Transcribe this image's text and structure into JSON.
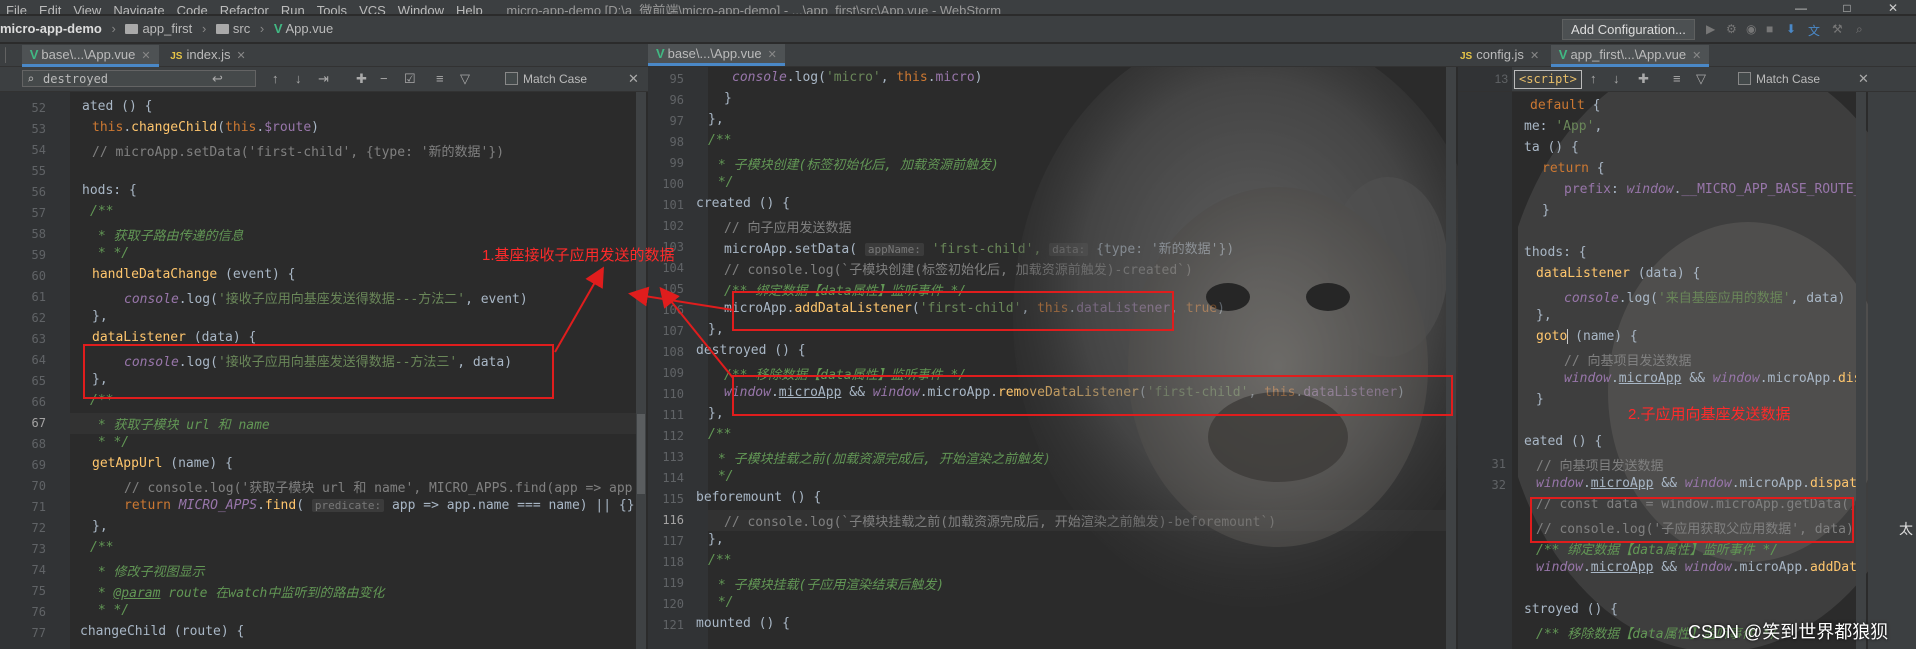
{
  "menu": [
    "File",
    "Edit",
    "View",
    "Navigate",
    "Code",
    "Refactor",
    "Run",
    "Tools",
    "VCS",
    "Window",
    "Help"
  ],
  "window_title": "micro-app-demo [D:\\a_微前端\\micro-app-demo] - ...\\app_first\\src\\App.vue - WebStorm",
  "breadcrumbs": [
    "micro-app-demo",
    "app_first",
    "src",
    "App.vue"
  ],
  "toolbar": {
    "add_config": "Add Configuration..."
  },
  "left_panel": {
    "tabs": [
      {
        "label": "base\\...\\App.vue",
        "active": true
      },
      {
        "label": "index.js",
        "active": false
      }
    ],
    "search": "destroyed",
    "match_case": "Match Case",
    "line_numbers": [
      "52",
      "53",
      "54",
      "55",
      "56",
      "57",
      "58",
      "59",
      "60",
      "61",
      "62",
      "63",
      "64",
      "65",
      "66",
      "67",
      "68",
      "69",
      "70",
      "71",
      "72",
      "73",
      "74",
      "75",
      "76",
      "77"
    ],
    "lines": [
      "ated () {",
      "this.changeChild(this.$route)",
      "// microApp.setData('first-child', {type: '新的数据'})",
      "",
      "hods: {",
      "/**",
      " * 获取子路由传递的信息",
      " * */",
      "handleDataChange (event) {",
      "console.log('接收子应用向基座发送得数据---方法二', event)",
      "},",
      "dataListener (data) {",
      "console.log('接收子应用向基座发送得数据--方法三', data)",
      "},",
      "/**",
      " * 获取子模块 url 和 name",
      " * */",
      "getAppUrl (name) {",
      "// console.log('获取子模块 url 和 name', MICRO_APPS.find(app => app",
      "return MICRO_APPS.find(",
      "predicate:",
      "app => app.name === name) || {}",
      "},",
      "/**",
      " * 修改子视图显示",
      " * @param route 在watch中监听到的路由变化",
      " * */",
      "changeChild (route) {"
    ],
    "annotation": "1.基座接收子应用发送的数据"
  },
  "middle_panel": {
    "tabs": [
      {
        "label": "base\\...\\App.vue",
        "active": true
      }
    ],
    "line_numbers": [
      "95",
      "96",
      "97",
      "98",
      "99",
      "100",
      "101",
      "102",
      "103",
      "104",
      "105",
      "106",
      "107",
      "108",
      "109",
      "110",
      "111",
      "112",
      "113",
      "114",
      "115",
      "116",
      "117",
      "118",
      "119",
      "120",
      "121"
    ],
    "lines": {
      "l95": "console.log('micro', this.micro)",
      "l96": "}",
      "l97": "},",
      "l98": "/**",
      "l99": " * 子模块创建(标签初始化后, 加载资源前触发)",
      "l100": " */",
      "l101": "created () {",
      "l102": "// 向子应用发送数据",
      "l103a": "microApp.setData(",
      "l103h1": "appName:",
      "l103b": "'first-child',",
      "l103h2": "data:",
      "l103c": "{type: '新的数据'})",
      "l104": "// console.log(`子模块创建(标签初始化后, 加载资源前触发)-created`)",
      "l105": "/** 绑定数据【data属性】监听事件 */",
      "l106": "microApp.addDataListener('first-child', this.dataListener, true)",
      "l107": "},",
      "l108": "destroyed () {",
      "l109": "/** 移除数据【data属性】监听事件 */",
      "l110": "window.microApp && window.microApp.removeDataListener('first-child', this.dataListener)",
      "l111": "},",
      "l112": "/**",
      "l113": " * 子模块挂载之前(加载资源完成后, 开始渲染之前触发)",
      "l114": " */",
      "l115": "beforemount () {",
      "l116": "// console.log(`子模块挂载之前(加载资源完成后, 开始渲染之前触发)-beforemount`)",
      "l117": "},",
      "l118": "/**",
      "l119": " * 子模块挂载(子应用渲染结束后触发)",
      "l120": " */",
      "l121": "mounted () {"
    }
  },
  "right_panel": {
    "tabs": [
      {
        "label": "config.js",
        "active": false
      },
      {
        "label": "app_first\\...\\App.vue",
        "active": true
      }
    ],
    "match_case": "Match Case",
    "script_tag": "<script>",
    "line_numbers": [
      "13",
      "",
      "",
      "",
      "",
      "",
      "",
      "",
      "",
      "",
      "",
      "",
      "",
      "",
      "",
      "",
      "",
      "",
      "",
      "31",
      "32",
      "",
      "",
      "",
      "",
      "",
      ""
    ],
    "lines": {
      "r1": "default {",
      "r2": "me: 'App',",
      "r3": "ta () {",
      "r4": "return {",
      "r5": "prefix: window.__MICRO_APP_BASE_ROUTE__",
      "r6": "}",
      "r7": "",
      "r8": "thods: {",
      "r9": "dataListener (data) {",
      "r10": "console.log('来自基座应用的数据', data)",
      "r11": "},",
      "r12": "goto (name) {",
      "r13": "// 向基项目发送数据",
      "r14": "window.microApp && window.microApp.disp",
      "r15": "}",
      "r16": "",
      "r17": "eated () {",
      "r18": "// 向基项目发送数据",
      "r19": "window.microApp && window.microApp.dispatch",
      "r20": "// const data = window.microApp.getData()",
      "r21": "// console.log('子应用获取父应用数据', data)",
      "r22": "/** 绑定数据【data属性】监听事件 */",
      "r23": "window.microApp && window.microApp.addDataL",
      "r24": "",
      "r25": "stroyed () {",
      "r26": "/** 移除数据【data属性】监听事件 */"
    },
    "annotation": "2.子应用向基座发送数据",
    "overflow_char": "太"
  },
  "watermark": "CSDN @笑到世界都狼狈",
  "colors": {
    "annotation_red": "#e01d1d",
    "editor_bg": "#2b2b2b",
    "keyword": "#cc7832",
    "string": "#6a8759"
  }
}
